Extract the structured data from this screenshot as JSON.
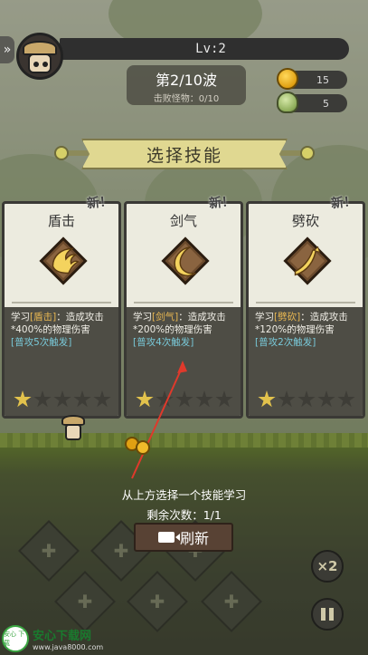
{
  "hud": {
    "side_tab_icon": "»",
    "level": "Lv:2",
    "wave_title": "第2/10波",
    "wave_sub": "击败怪物：0/10",
    "coins": "15",
    "gems": "5"
  },
  "banner": {
    "title": "选择技能"
  },
  "cards": [
    {
      "name": "盾击",
      "new_label": "新！",
      "desc_prefix": "学习",
      "skill_tag": "[盾击]",
      "desc_body": "：造成攻击*400%的物理伤害",
      "trigger": "[普攻5次触发]",
      "stars": 1,
      "stars_total": 5,
      "emblem_color": "#f4d35e"
    },
    {
      "name": "剑气",
      "new_label": "新！",
      "desc_prefix": "学习",
      "skill_tag": "[剑气]",
      "desc_body": "：造成攻击*200%的物理伤害",
      "trigger": "[普攻4次触发]",
      "stars": 1,
      "stars_total": 5,
      "emblem_color": "#f4d35e"
    },
    {
      "name": "劈砍",
      "new_label": "新！",
      "desc_prefix": "学习",
      "skill_tag": "[劈砍]",
      "desc_body": "：造成攻击*120%的物理伤害",
      "trigger": "[普攻2次触发]",
      "stars": 1,
      "stars_total": 5,
      "emblem_color": "#f4d35e"
    }
  ],
  "prompt": {
    "hint": "从上方选择一个技能学习",
    "remaining": "剩余次数：1/1",
    "refresh_label": "刷新",
    "refresh_icon": "video-camera-icon"
  },
  "controls": {
    "speed_label": "×2",
    "pause_icon": "pause-icon"
  },
  "watermark": {
    "logo_text": "安心 下载",
    "title": "安心下载网",
    "url": "www.java8000.com"
  },
  "colors": {
    "highlight": "#e8b752",
    "trigger": "#79c9d9",
    "star_on": "#e2c24c",
    "arrow": "#e0392b"
  }
}
